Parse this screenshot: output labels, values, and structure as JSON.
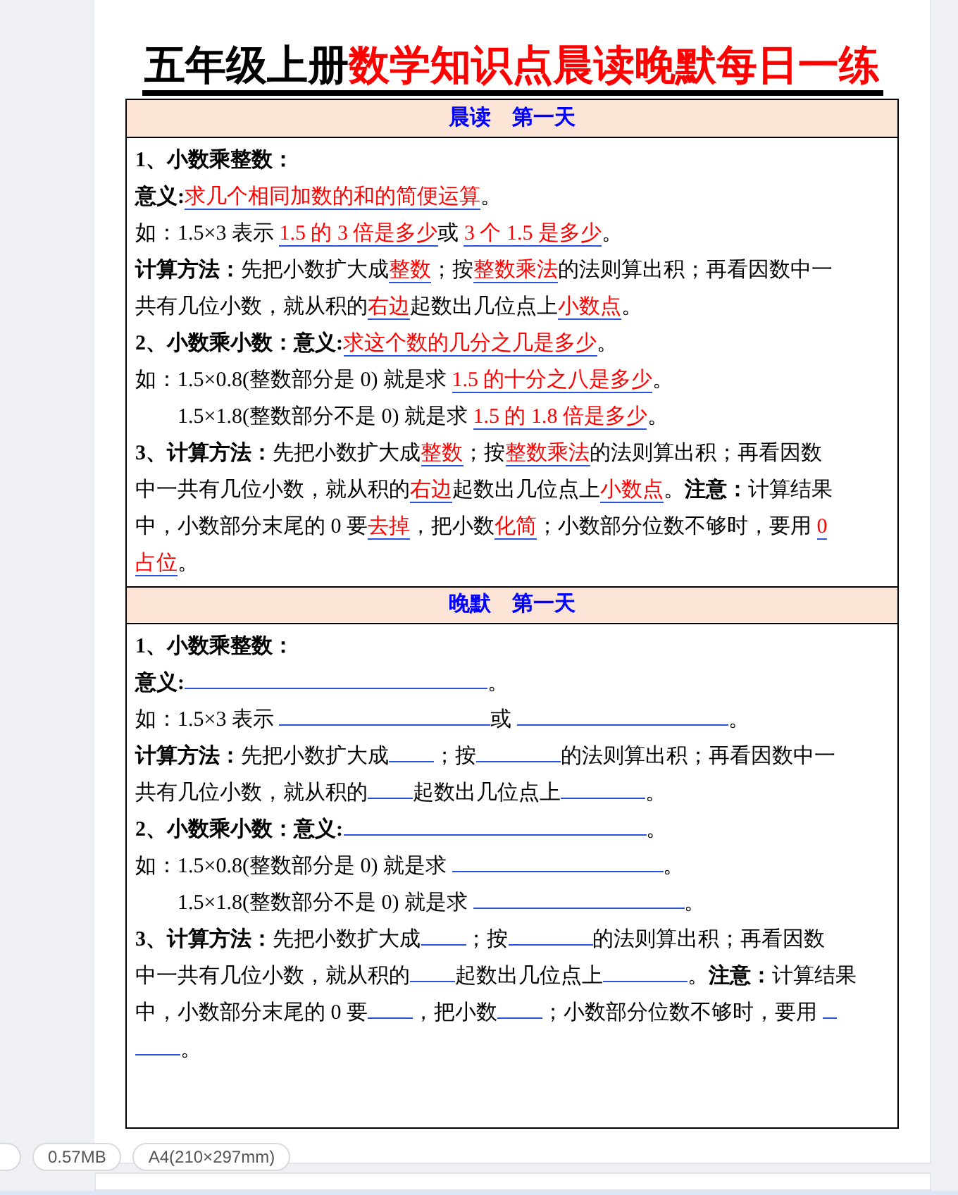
{
  "document": {
    "title": [
      {
        "kind": "plain",
        "text": "五年级上册"
      },
      {
        "kind": "accent",
        "text": "数学知识点晨读晚默每日一练"
      }
    ],
    "sections": [
      {
        "heading": "晨读　第一天",
        "lines": [
          {
            "segments": [
              {
                "kind": "bold",
                "text": "1、小数乘整数："
              }
            ]
          },
          {
            "segments": [
              {
                "kind": "bold",
                "text": "意义:"
              },
              {
                "kind": "answer",
                "text": "求几个相同加数的和的简便运算"
              },
              {
                "kind": "text",
                "text": "。"
              }
            ]
          },
          {
            "segments": [
              {
                "kind": "text",
                "text": "如：1.5×3 表示 "
              },
              {
                "kind": "answer",
                "text": "1.5 的 3 倍是多少"
              },
              {
                "kind": "text",
                "text": "或 "
              },
              {
                "kind": "answer",
                "text": "3 个 1.5 是多少"
              },
              {
                "kind": "text",
                "text": "。"
              }
            ]
          },
          {
            "segments": [
              {
                "kind": "bold",
                "text": "计算方法："
              },
              {
                "kind": "text",
                "text": "先把小数扩大成"
              },
              {
                "kind": "answer",
                "text": "整数"
              },
              {
                "kind": "text",
                "text": "；按"
              },
              {
                "kind": "answer",
                "text": "整数乘法"
              },
              {
                "kind": "text",
                "text": "的法则算出积；再看因数中一"
              }
            ]
          },
          {
            "segments": [
              {
                "kind": "text",
                "text": "共有几位小数，就从积的"
              },
              {
                "kind": "answer",
                "text": "右边"
              },
              {
                "kind": "text",
                "text": "起数出几位点上"
              },
              {
                "kind": "answer",
                "text": "小数点"
              },
              {
                "kind": "text",
                "text": "。"
              }
            ]
          },
          {
            "segments": [
              {
                "kind": "bold",
                "text": "2、小数乘小数：意义:"
              },
              {
                "kind": "answer",
                "text": "求这个数的几分之几是多少"
              },
              {
                "kind": "text",
                "text": "。"
              }
            ]
          },
          {
            "segments": [
              {
                "kind": "text",
                "text": "如：1.5×0.8(整数部分是 0) 就是求 "
              },
              {
                "kind": "answer",
                "text": "1.5 的十分之八是多少"
              },
              {
                "kind": "text",
                "text": "。"
              }
            ]
          },
          {
            "segments": [
              {
                "kind": "text",
                "text": "　　1.5×1.8(整数部分不是 0) 就是求 "
              },
              {
                "kind": "answer",
                "text": "1.5 的 1.8 倍是多少"
              },
              {
                "kind": "text",
                "text": "。"
              }
            ]
          },
          {
            "segments": [
              {
                "kind": "bold",
                "text": "3、计算方法："
              },
              {
                "kind": "text",
                "text": "先把小数扩大成"
              },
              {
                "kind": "answer",
                "text": "整数"
              },
              {
                "kind": "text",
                "text": "；按"
              },
              {
                "kind": "answer",
                "text": "整数乘法"
              },
              {
                "kind": "text",
                "text": "的法则算出积；再看因数"
              }
            ]
          },
          {
            "segments": [
              {
                "kind": "text",
                "text": "中一共有几位小数，就从积的"
              },
              {
                "kind": "answer",
                "text": "右边"
              },
              {
                "kind": "text",
                "text": "起数出几位点上"
              },
              {
                "kind": "answer",
                "text": "小数点"
              },
              {
                "kind": "text",
                "text": "。"
              },
              {
                "kind": "bold",
                "text": "注意："
              },
              {
                "kind": "text",
                "text": "计算结果"
              }
            ]
          },
          {
            "segments": [
              {
                "kind": "text",
                "text": "中，小数部分末尾的 0 要"
              },
              {
                "kind": "answer",
                "text": "去掉"
              },
              {
                "kind": "text",
                "text": "，把小数"
              },
              {
                "kind": "answer",
                "text": "化简"
              },
              {
                "kind": "text",
                "text": "；小数部分位数不够时，要用 "
              },
              {
                "kind": "answer",
                "text": "0"
              }
            ]
          },
          {
            "segments": [
              {
                "kind": "answer",
                "text": "占位"
              },
              {
                "kind": "text",
                "text": "。"
              }
            ]
          }
        ]
      },
      {
        "heading": "晚默　第一天",
        "lines": [
          {
            "segments": [
              {
                "kind": "bold",
                "text": "1、小数乘整数："
              }
            ]
          },
          {
            "segments": [
              {
                "kind": "bold",
                "text": "意义:"
              },
              {
                "kind": "wide_blank"
              },
              {
                "kind": "text",
                "text": "。"
              }
            ]
          },
          {
            "segments": [
              {
                "kind": "text",
                "text": "如：1.5×3 表示 "
              },
              {
                "kind": "long_blank"
              },
              {
                "kind": "text",
                "text": "或 "
              },
              {
                "kind": "long_blank"
              },
              {
                "kind": "text",
                "text": "。"
              }
            ]
          },
          {
            "segments": [
              {
                "kind": "bold",
                "text": "计算方法："
              },
              {
                "kind": "text",
                "text": "先把小数扩大成"
              },
              {
                "kind": "short_blank"
              },
              {
                "kind": "text",
                "text": "；按"
              },
              {
                "kind": "medium_blank"
              },
              {
                "kind": "text",
                "text": "的法则算出积；再看因数中一"
              }
            ]
          },
          {
            "segments": [
              {
                "kind": "text",
                "text": "共有几位小数，就从积的"
              },
              {
                "kind": "short_blank"
              },
              {
                "kind": "text",
                "text": "起数出几位点上"
              },
              {
                "kind": "medium_blank"
              },
              {
                "kind": "text",
                "text": "。"
              }
            ]
          },
          {
            "segments": [
              {
                "kind": "bold",
                "text": "2、小数乘小数：意义:"
              },
              {
                "kind": "wide_blank"
              },
              {
                "kind": "text",
                "text": "。"
              }
            ]
          },
          {
            "segments": [
              {
                "kind": "text",
                "text": "如：1.5×0.8(整数部分是 0) 就是求 "
              },
              {
                "kind": "long_blank"
              },
              {
                "kind": "text",
                "text": "。"
              }
            ]
          },
          {
            "segments": [
              {
                "kind": "text",
                "text": "　　1.5×1.8(整数部分不是 0) 就是求 "
              },
              {
                "kind": "long_blank"
              },
              {
                "kind": "text",
                "text": "。"
              }
            ]
          },
          {
            "segments": [
              {
                "kind": "bold",
                "text": "3、计算方法："
              },
              {
                "kind": "text",
                "text": "先把小数扩大成"
              },
              {
                "kind": "short_blank"
              },
              {
                "kind": "text",
                "text": "；按"
              },
              {
                "kind": "medium_blank"
              },
              {
                "kind": "text",
                "text": "的法则算出积；再看因数"
              }
            ]
          },
          {
            "segments": [
              {
                "kind": "text",
                "text": "中一共有几位小数，就从积的"
              },
              {
                "kind": "short_blank"
              },
              {
                "kind": "text",
                "text": "起数出几位点上"
              },
              {
                "kind": "medium_blank"
              },
              {
                "kind": "text",
                "text": "。"
              },
              {
                "kind": "bold",
                "text": "注意："
              },
              {
                "kind": "text",
                "text": "计算结果"
              }
            ]
          },
          {
            "segments": [
              {
                "kind": "text",
                "text": "中，小数部分末尾的 0 要"
              },
              {
                "kind": "short_blank"
              },
              {
                "kind": "text",
                "text": "，把小数"
              },
              {
                "kind": "short_blank"
              },
              {
                "kind": "text",
                "text": "；小数部分位数不够时，要用 "
              },
              {
                "kind": "tiny_blank"
              }
            ]
          },
          {
            "segments": [
              {
                "kind": "short_blank"
              },
              {
                "kind": "text",
                "text": "。"
              }
            ]
          }
        ]
      }
    ]
  },
  "file_info": [
    "0.57MB",
    "A4(210×297mm)"
  ]
}
